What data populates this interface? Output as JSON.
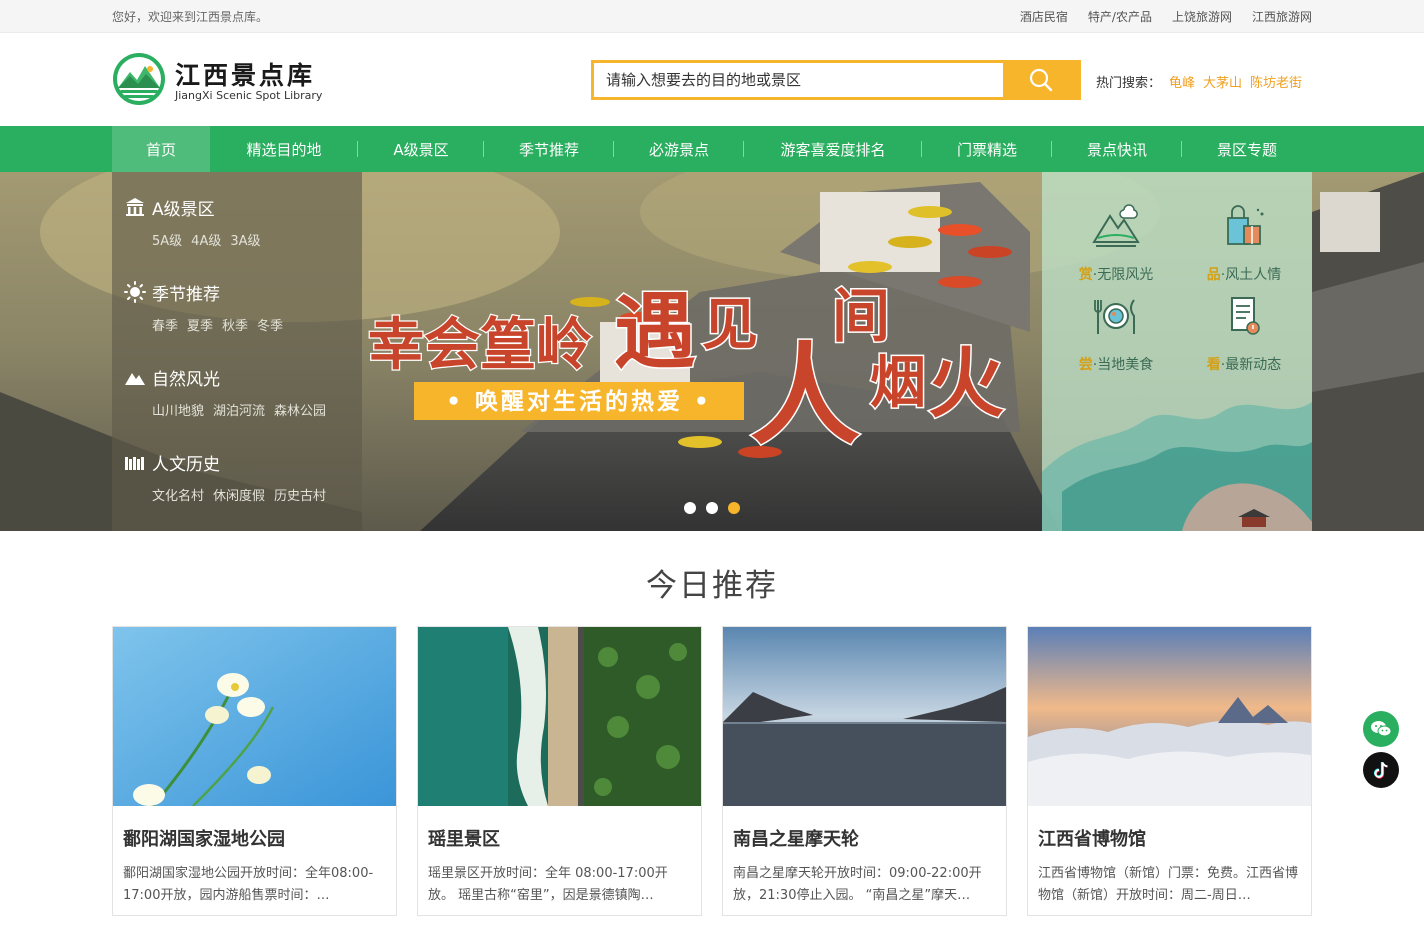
{
  "topbar": {
    "welcome": "您好，欢迎来到江西景点库。",
    "links": [
      "酒店民宿",
      "特产/农产品",
      "上饶旅游网",
      "江西旅游网"
    ]
  },
  "logo": {
    "title": "江西景点库",
    "subtitle": "JiangXi Scenic Spot Library"
  },
  "search": {
    "placeholder": "请输入想要去的目的地或景区",
    "hot_label": "热门搜索：",
    "hot_keywords": [
      "龟峰",
      "大茅山",
      "陈坊老街"
    ]
  },
  "nav": {
    "items": [
      "首页",
      "精选目的地",
      "A级景区",
      "季节推荐",
      "必游景点",
      "游客喜爱度排名",
      "门票精选",
      "景点快讯",
      "景区专题"
    ],
    "active_index": 0
  },
  "side_menu": [
    {
      "title": "A级景区",
      "icon": "building-icon",
      "subs": [
        "5A级",
        "4A级",
        "3A级"
      ]
    },
    {
      "title": "季节推荐",
      "icon": "sun-icon",
      "subs": [
        "春季",
        "夏季",
        "秋季",
        "冬季"
      ]
    },
    {
      "title": "自然风光",
      "icon": "mountain-icon",
      "subs": [
        "山川地貌",
        "湖泊河流",
        "森林公园"
      ]
    },
    {
      "title": "人文历史",
      "icon": "archive-icon",
      "subs": [
        "文化名村",
        "休闲度假",
        "历史古村"
      ]
    }
  ],
  "banner": {
    "headline_left": "幸会篁岭",
    "headline_right": [
      "遇",
      "见",
      "人",
      "间",
      "烟",
      "火"
    ],
    "tagline": "• 唤醒对生活的热爱 •",
    "slide_count": 3,
    "active_slide": 3
  },
  "promo": [
    {
      "key": "赏",
      "label": "·无限风光",
      "icon": "landscape-icon"
    },
    {
      "key": "品",
      "label": "·风土人情",
      "icon": "shopping-bag-icon"
    },
    {
      "key": "尝",
      "label": "·当地美食",
      "icon": "food-icon"
    },
    {
      "key": "看",
      "label": "·最新动态",
      "icon": "news-icon"
    }
  ],
  "recommend": {
    "title": "今日推荐",
    "cards": [
      {
        "title": "鄱阳湖国家湿地公园",
        "desc": "鄱阳湖国家湿地公园开放时间：全年08:00-17:00开放，园内游船售票时间：…"
      },
      {
        "title": "瑶里景区",
        "desc": "瑶里景区开放时间：全年 08:00-17:00开放。 瑶里古称“窑里”，因是景德镇陶…"
      },
      {
        "title": "南昌之星摩天轮",
        "desc": "南昌之星摩天轮开放时间：09:00-22:00开放，21:30停止入园。 “南昌之星”摩天…"
      },
      {
        "title": "江西省博物馆",
        "desc": "江西省博物馆（新馆）门票：免费。江西省博物馆（新馆）开放时间：周二-周日…"
      }
    ]
  },
  "floating": [
    "wechat-icon",
    "tiktok-icon"
  ],
  "colors": {
    "brand_green": "#2aae5f",
    "accent_orange": "#f7b52c",
    "headline_red": "#c8442a"
  }
}
